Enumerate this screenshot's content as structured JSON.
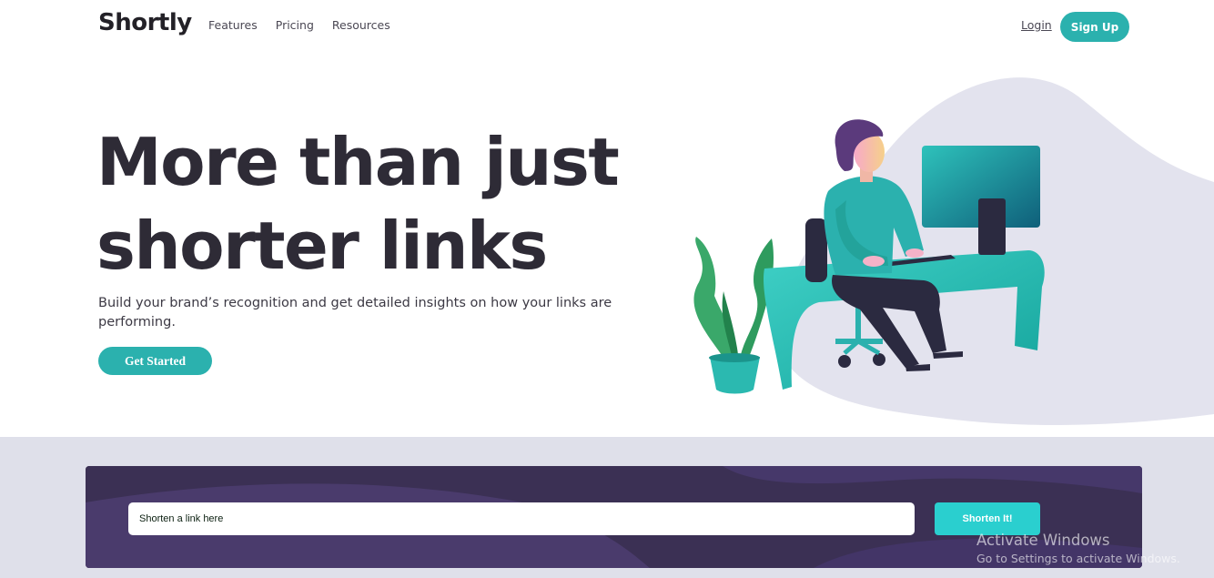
{
  "header": {
    "logo": "Shortly",
    "nav": [
      {
        "label": "Features"
      },
      {
        "label": "Pricing"
      },
      {
        "label": "Resources"
      }
    ],
    "login_label": "Login",
    "signup_label": "Sign Up"
  },
  "hero": {
    "title_line1": "More than just",
    "title_line2": "shorter links",
    "subtitle": "Build your brand’s recognition and get detailed insights on how your links are performing.",
    "cta_label": "Get Started"
  },
  "shorten": {
    "placeholder": "Shorten a link here",
    "button_label": "Shorten It!"
  },
  "watermark": {
    "title": "Activate Windows",
    "subtitle": "Go to Settings to activate Windows."
  },
  "colors": {
    "accent": "#2bb1ae",
    "accent_bright": "#2acfcf",
    "dark_violet": "#3b3054",
    "heading": "#2e2b36",
    "band": "#dfe0ea"
  }
}
